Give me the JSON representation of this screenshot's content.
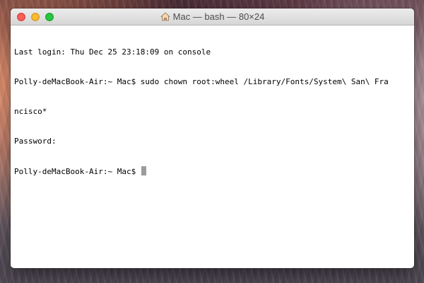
{
  "window": {
    "title": "Mac — bash — 80×24",
    "title_icon": "home-icon",
    "buttons": {
      "close": "close-button",
      "minimize": "minimize-button",
      "zoom": "zoom-button"
    }
  },
  "terminal": {
    "lines": [
      "Last login: Thu Dec 25 23:18:09 on console",
      "Polly-deMacBook-Air:~ Mac$ sudo chown root:wheel /Library/Fonts/System\\ San\\ Fra",
      "ncisco*",
      "Password:"
    ],
    "prompt": "Polly-deMacBook-Air:~ Mac$ ",
    "cursor_color": "#9b9b9b"
  },
  "colors": {
    "close": "#fc5f57",
    "minimize": "#fdbc2e",
    "zoom": "#27c840"
  }
}
